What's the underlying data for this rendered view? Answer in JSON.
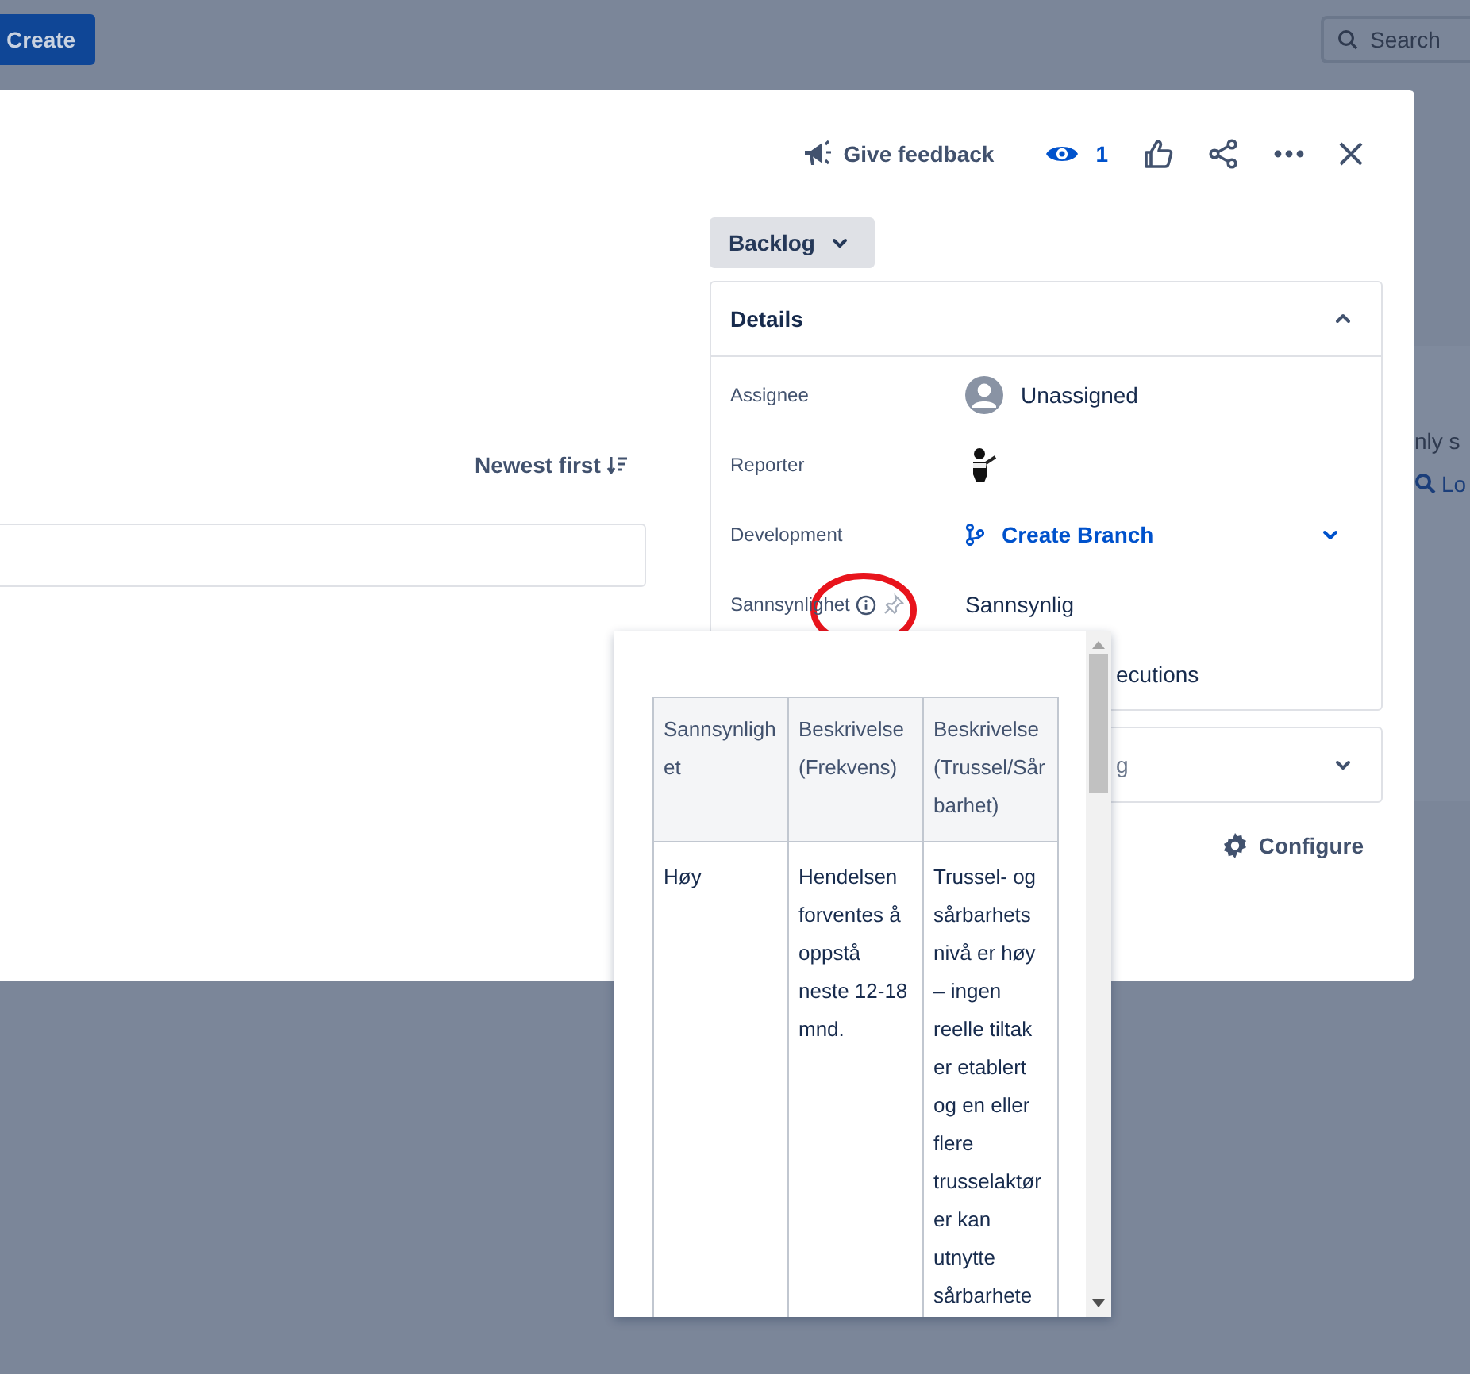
{
  "top_bar": {
    "create_button": "Create",
    "search": {
      "placeholder": "Search"
    }
  },
  "background": {
    "texts": [
      {
        "kind": "text",
        "value": "nly s"
      },
      {
        "kind": "search-link",
        "value": "Lo"
      }
    ]
  },
  "header": {
    "feedback": "Give feedback",
    "watchers": "1"
  },
  "status_button": "Backlog",
  "activity": {
    "sort": "Newest first"
  },
  "details": {
    "title": "Details",
    "expanded": true,
    "fields": [
      {
        "kind": "user",
        "label": "Assignee",
        "value": "Unassigned"
      },
      {
        "kind": "avatar",
        "label": "Reporter"
      },
      {
        "kind": "branch",
        "label": "Development",
        "value": "Create Branch"
      },
      {
        "kind": "info",
        "label": "Sannsynlighet",
        "value": "Sannsynlig"
      },
      {
        "kind": "partial",
        "value": "ecutions"
      }
    ]
  },
  "second_panel": {
    "title": "g",
    "expanded": false
  },
  "configure": "Configure",
  "tooltip": {
    "table": {
      "columns": [
        "Sannsynlighet",
        "Beskrivelse (Frekvens)",
        "Beskrivelse (Trussel/Sårbarhet)"
      ],
      "rows": [
        [
          "Høy",
          "Hendelsen forventes å oppstå neste 12-18 mnd.",
          "Trussel- og sårbarhets nivå er høy – ingen reelle tiltak er etablert og en eller flere trusselaktører kan utnytte sårbarhete"
        ]
      ]
    }
  }
}
